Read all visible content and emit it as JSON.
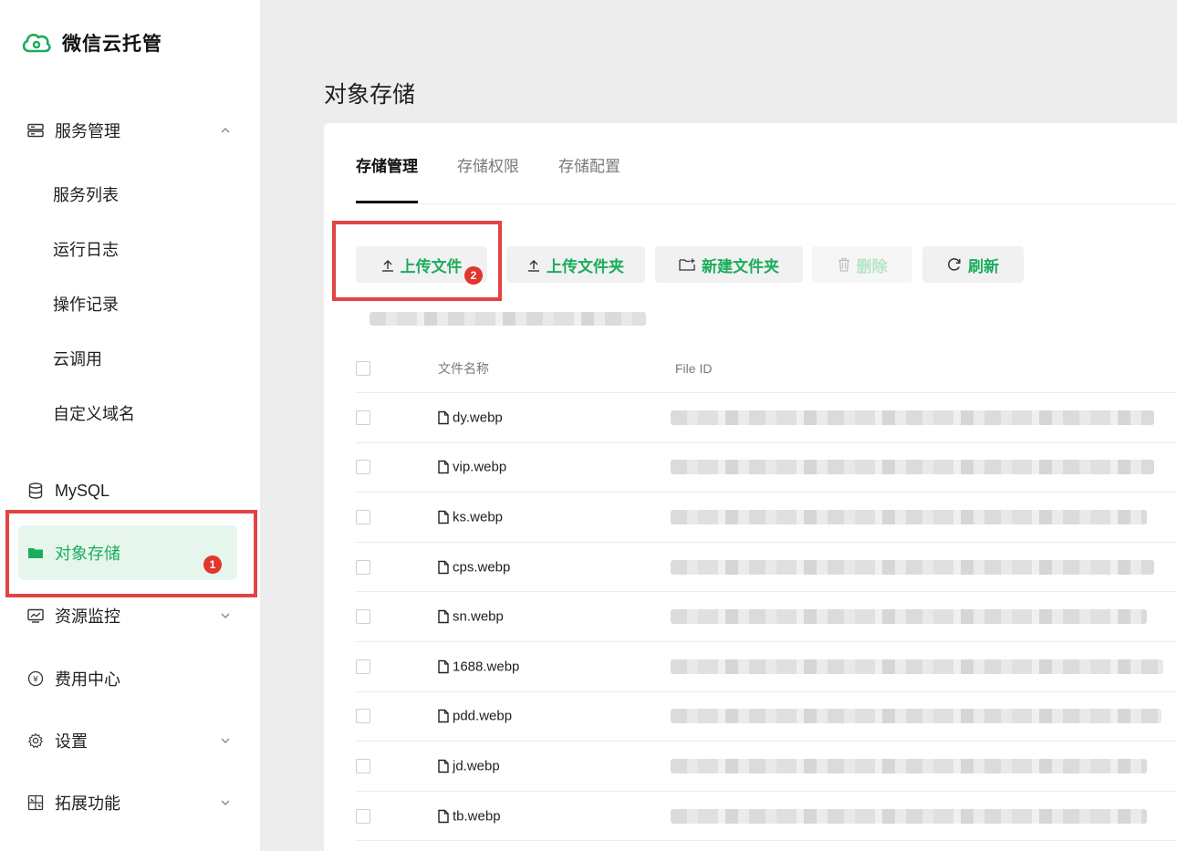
{
  "brand": {
    "name": "微信云托管"
  },
  "sidebar": {
    "service_mgmt": "服务管理",
    "sub_items": [
      "服务列表",
      "运行日志",
      "操作记录",
      "云调用",
      "自定义域名"
    ],
    "mysql": "MySQL",
    "object_storage": "对象存储",
    "resource_monitor": "资源监控",
    "billing": "费用中心",
    "settings": "设置",
    "extensions": "拓展功能",
    "badge_1": "1"
  },
  "main": {
    "page_title": "对象存储",
    "tabs": [
      "存储管理",
      "存储权限",
      "存储配置"
    ],
    "active_tab": "存储管理",
    "toolbar": {
      "upload_file": "上传文件",
      "upload_folder": "上传文件夹",
      "new_folder": "新建文件夹",
      "delete": "删除",
      "refresh": "刷新",
      "badge_2": "2"
    },
    "table": {
      "col_name": "文件名称",
      "col_file_id": "File ID",
      "rows": [
        "dy.webp",
        "vip.webp",
        "ks.webp",
        "cps.webp",
        "sn.webp",
        "1688.webp",
        "pdd.webp",
        "jd.webp",
        "tb.webp"
      ]
    }
  },
  "colors": {
    "accent": "#1aad5c",
    "highlight_red": "#e24444",
    "active_bg": "#e6f6ec"
  },
  "icons": [
    "wechat-cloud-logo",
    "server-icon",
    "database-icon",
    "folder-icon",
    "monitor-icon",
    "yen-icon",
    "gear-icon",
    "extension-icon",
    "upload-icon",
    "new-folder-icon",
    "trash-icon",
    "refresh-icon",
    "file-icon",
    "chevron-up-icon",
    "chevron-down-icon"
  ]
}
